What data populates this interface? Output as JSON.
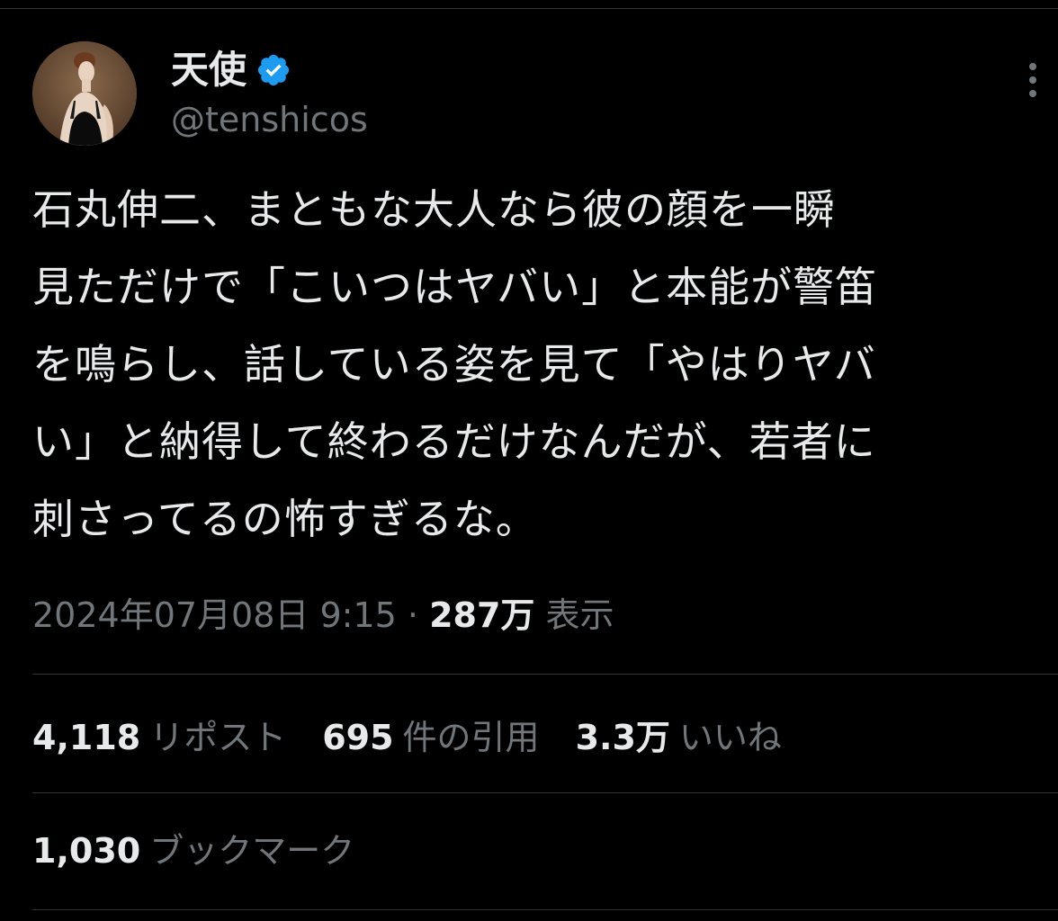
{
  "author": {
    "display_name": "天使",
    "handle": "@tenshicos",
    "verified": true,
    "verified_color": "#1d9bf0"
  },
  "tweet": {
    "text_lines": [
      "石丸伸二、まともな大人なら彼の顔を一瞬",
      "見ただけで「こいつはヤバい」と本能が警笛",
      "を鳴らし、話している姿を見て「やはりヤバ",
      "い」と納得して終わるだけなんだが、若者に",
      "刺さってるの怖すぎるな。"
    ],
    "timestamp": "2024年07月08日 9:15",
    "separator": " · ",
    "views_count": "287万",
    "views_label": "表示"
  },
  "stats": {
    "reposts_count": "4,118",
    "reposts_label": "リポスト",
    "quotes_count": "695",
    "quotes_label": "件の引用",
    "likes_count": "3.3万",
    "likes_label": "いいね",
    "bookmarks_count": "1,030",
    "bookmarks_label": "ブックマーク"
  },
  "icons": {
    "more": "vertical-ellipsis-icon",
    "verified": "verified-badge-icon",
    "avatar": "portrait-painting"
  },
  "colors": {
    "background": "#000000",
    "text_primary": "#e7e9ea",
    "text_secondary": "#71767b",
    "divider": "#2f3336"
  }
}
